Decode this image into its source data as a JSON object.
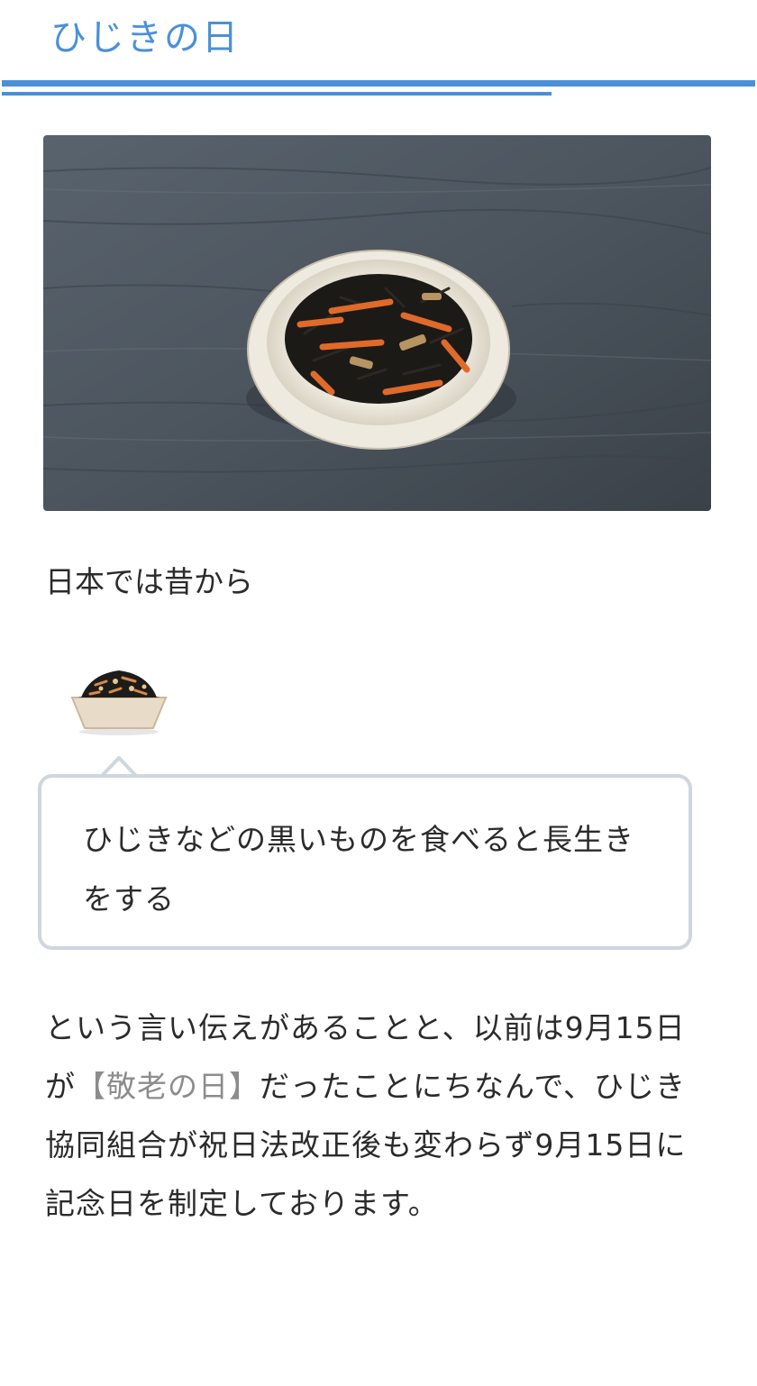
{
  "header": {
    "title": "ひじきの日"
  },
  "colors": {
    "accent": "#4a90d9",
    "bubble_border": "#cfd6de",
    "link_text": "#8c8c8c"
  },
  "hero": {
    "image": "hijiki-dish-photo"
  },
  "intro": {
    "text": "日本では昔から"
  },
  "speaker": {
    "icon": "hijiki-bowl-icon"
  },
  "bubble": {
    "text": "ひじきなどの黒いものを食べると長生きをする"
  },
  "body": {
    "part1": "という言い伝えがあることと、以前は9月15日が",
    "link": "【敬老の日】",
    "part2": "だったことにちなんで、ひじき協同組合が祝日法改正後も変わらず9月15日に記念日を制定しております。"
  }
}
